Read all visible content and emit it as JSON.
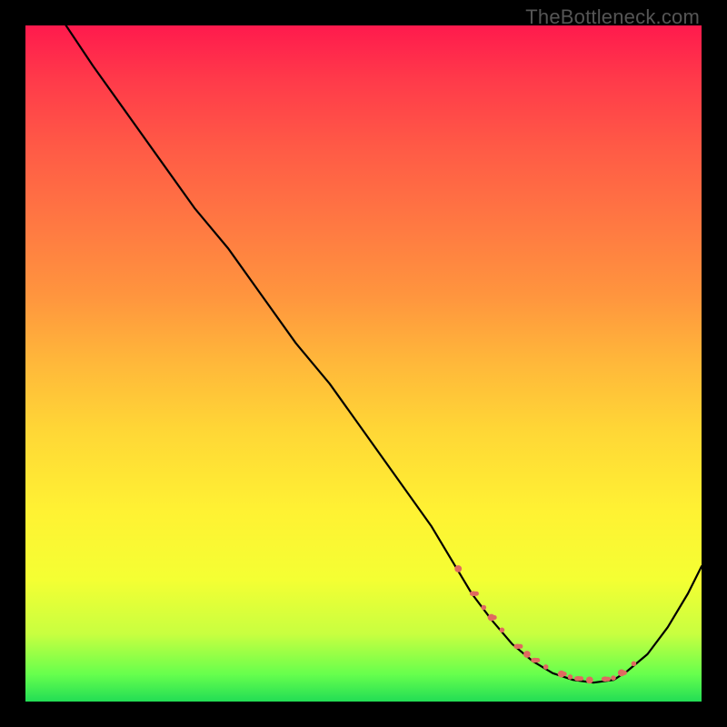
{
  "watermark": "TheBottleneck.com",
  "chart_data": {
    "type": "line",
    "title": "",
    "xlabel": "",
    "ylabel": "",
    "xlim": [
      0,
      100
    ],
    "ylim": [
      0,
      100
    ],
    "grid": false,
    "series": [
      {
        "name": "curve",
        "color": "#000000",
        "x": [
          6,
          10,
          15,
          20,
          25,
          30,
          35,
          40,
          45,
          50,
          55,
          60,
          63,
          66,
          69,
          72,
          75,
          78,
          81,
          84,
          87,
          89,
          92,
          95,
          98,
          100
        ],
        "values": [
          100,
          94,
          87,
          80,
          73,
          67,
          60,
          53,
          47,
          40,
          33,
          26,
          21,
          16,
          12,
          8.5,
          6,
          4.2,
          3.2,
          2.8,
          3.2,
          4.5,
          7,
          11,
          16,
          20
        ]
      }
    ],
    "highlight_band": {
      "name": "optimal-range",
      "color": "#e06a60",
      "x_start": 64,
      "x_end": 90,
      "y_level_approx": 4
    }
  }
}
